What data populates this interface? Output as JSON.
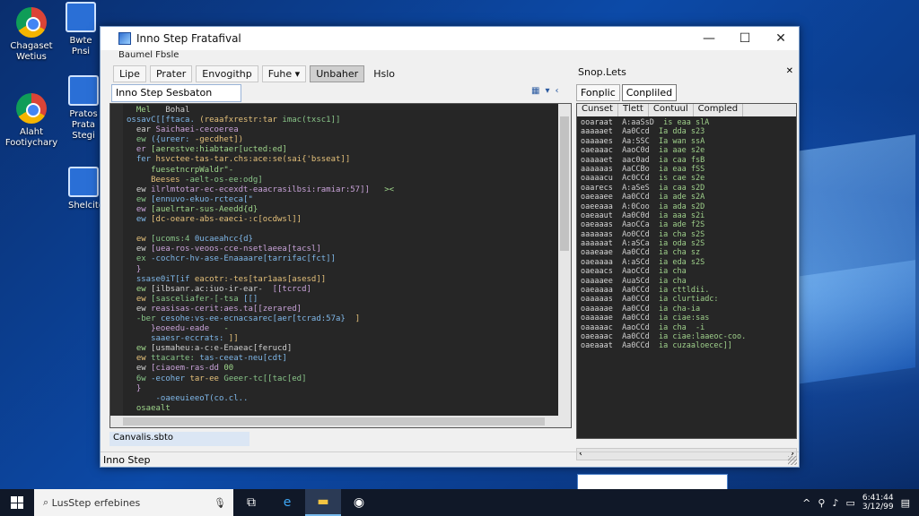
{
  "desktop": {
    "icons": [
      {
        "label": "Chagaset Wetius",
        "type": "chrome"
      },
      {
        "label": "Bwte Pnsi",
        "type": "square"
      },
      {
        "label": "Alaht Footiychary",
        "type": "chrome"
      },
      {
        "label": "Pratos Prata Stegi",
        "type": "square"
      },
      {
        "label": "Shelcito",
        "type": "square"
      }
    ]
  },
  "window": {
    "title": "Inno Step Fratafival",
    "subtitle": "Baumel Fbsle",
    "controls": {
      "minimize": "—",
      "maximize": "☐",
      "close": "✕"
    },
    "menu": [
      "Lipe",
      "Prater",
      "Envogithp",
      "Fuhe ▾",
      "Unbaher",
      "Hslo"
    ],
    "script_tab": "Inno Step Sesbaton",
    "code_lines": [
      "  Mel   Bohal",
      "ossavC[[ftaca. (reaafxrestr:tar imac(txsc1]]",
      "  ear Saichaei-cecoerea",
      "  ew ({ureer: -gecdhet])",
      "  er [aerestve:hiabtaer[ucted:ed]",
      "  fer hsvctee-tas-tar.chs:ace:se(sai{'bsseat]]",
      "     fuesetncrpWaldr\"-",
      "     Beeses -aelt-os-ee:odg]",
      "  ew ilrlmtotar-ec-ecexdt-eaacrasilbsi:ramiar:57]]   ><",
      "  ew [ennuvo-ekuo-rcteca[\"",
      "  ew [auelrtar-sus-Aeedd{d}",
      "  ew [dc-oeare-abs-eaeci-:c[ocdwsl]]",
      "",
      "  ew [ucoms:4 0ucaeahcc{d}",
      "  ew [uea-ros-veoos-cce-nsetlaeea[tacsl]",
      "  ex -cochcr-hv-ase-Enaaaare[tarrifac[fct]]",
      "  }",
      "  ssase0iT[if eacotr:-tes[tar1aas[asesd]]",
      "  ew [ilbsanr.ac:iuo-ir-ear-  [[tcrcd]",
      "  ew [sasceliafer-[-tsa [[]",
      "  ew reasisas-cerit:aes.ta[[zerared]",
      "  -ber cesohe:vs-ee-ecnacsarec[aer[tcrad:57a}  ]",
      "     }eoeedu-eade   -",
      "     saaesr-eccrats: ]]",
      "  ew [usmaheu:a-c:e-Enaeac[ferucd]",
      "  ew ttacarte: tas-ceeat-neu[cdt]",
      "  ew [ciaoem-ras-dd 00",
      "  6w -ecoher tar-ee Geeer-tc[[tac[ed]",
      "  }",
      "      -oaeeuieeoT(co.cl..",
      "  osaealt"
    ],
    "left_status": "Canvalis.sbto",
    "bottom_status": "Inno Step"
  },
  "right_panel": {
    "title": "Snop.Lets",
    "close": "✕",
    "tabs": [
      "Fonplic",
      "Conpliled"
    ],
    "columns": [
      "Cunset",
      "Tlett",
      "Contuul",
      "Compled"
    ],
    "rows": [
      [
        "ooaraat",
        "A:aaSsD",
        "is eaa slA"
      ],
      [
        "aaaaaet",
        "Aa0Ccd",
        "Ia dda s23"
      ],
      [
        "oaaaaes",
        "Aa:SSC",
        "Ia wan ssA"
      ],
      [
        "oaeaaac",
        "AaoC0d",
        "ia aae s2e"
      ],
      [
        "oaaaaet",
        "aac0ad",
        "ia caa fsB"
      ],
      [
        "aaaaaas",
        "AaCCBo",
        "ia eaa fSS"
      ],
      [
        "oaaaacu",
        "Ac0CCd",
        "is cae s2e"
      ],
      [
        "oaarecs",
        "A:aSeS",
        "ia caa s2D"
      ],
      [
        "oaeaaee",
        "Aa0CCd",
        "ia ade s2A"
      ],
      [
        "oaeeaaa",
        "A:0Coo",
        "ia ada s2D"
      ],
      [
        "oaeaaut",
        "Aa0C0d",
        "ia aaa s2i"
      ],
      [
        "oaeaaas",
        "AaoCCa",
        "ia ade f2S"
      ],
      [
        "aaaaaas",
        "Ao0CCd",
        "ia cha s2S"
      ],
      [
        "aaaaaat",
        "A:aSCa",
        "ia oda s2S"
      ],
      [
        "oaaeaae",
        "Aa0CCd",
        "ia cha sz"
      ],
      [
        "oaeaaaa",
        "A:aSCd",
        "ia eda s2S"
      ],
      [
        "oaeaacs",
        "AaoCCd",
        "ia cha"
      ],
      [
        "oaaaaee",
        "AuaSCd",
        "ia cha"
      ],
      [
        "oaeaaaa",
        "Aa0CCd",
        "ia cttldii."
      ],
      [
        "oaaaaas",
        "Aa0CCd",
        "ia clurtiadc:"
      ],
      [
        "oaaaaae",
        "Aa0CCd",
        "ia cha-ia"
      ],
      [
        "oaaaaae",
        "Aa0CCd",
        "ia ciae:sas"
      ],
      [
        "oaaaaac",
        "AaoCCd",
        "ia cha  -i"
      ],
      [
        "oaeaaac",
        "Aa0CCd",
        "ia ciae:laaeoc-coo."
      ],
      [
        "oaeaaat",
        "Aa0CCd",
        "ia cuzaaloecec]]"
      ]
    ]
  },
  "taskbar": {
    "search_placeholder": "LusStep erfebines",
    "clock_time": "6:41:44",
    "clock_date": "3/12/99",
    "icons": [
      "task-view",
      "edge",
      "file-explorer",
      "chrome"
    ]
  }
}
